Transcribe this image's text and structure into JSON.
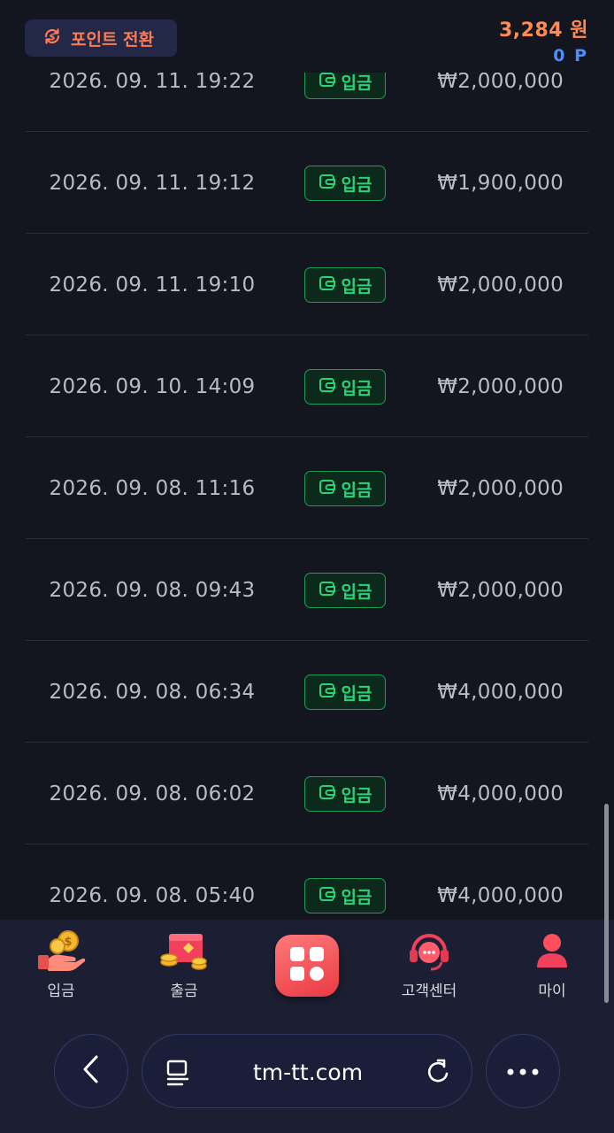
{
  "header": {
    "convert_button_label": "포인트 전환",
    "balance_won": "3,284 원",
    "balance_points": "0 P"
  },
  "transactions": [
    {
      "datetime": "2026. 09. 11. 19:22",
      "type": "입금",
      "amount": "₩2,000,000"
    },
    {
      "datetime": "2026. 09. 11. 19:12",
      "type": "입금",
      "amount": "₩1,900,000"
    },
    {
      "datetime": "2026. 09. 11. 19:10",
      "type": "입금",
      "amount": "₩2,000,000"
    },
    {
      "datetime": "2026. 09. 10. 14:09",
      "type": "입금",
      "amount": "₩2,000,000"
    },
    {
      "datetime": "2026. 09. 08. 11:16",
      "type": "입금",
      "amount": "₩2,000,000"
    },
    {
      "datetime": "2026. 09. 08. 09:43",
      "type": "입금",
      "amount": "₩2,000,000"
    },
    {
      "datetime": "2026. 09. 08. 06:34",
      "type": "입금",
      "amount": "₩4,000,000"
    },
    {
      "datetime": "2026. 09. 08. 06:02",
      "type": "입금",
      "amount": "₩4,000,000"
    },
    {
      "datetime": "2026. 09. 08. 05:40",
      "type": "입금",
      "amount": "₩4,000,000"
    }
  ],
  "bottom_nav": {
    "deposit_label": "입금",
    "withdraw_label": "출금",
    "support_label": "고객센터",
    "my_label": "마이"
  },
  "browser": {
    "url": "tm-tt.com"
  },
  "icons": {
    "convert": "currency-exchange-icon",
    "badge": "wallet-icon",
    "deposit": "coin-hand-icon",
    "withdraw": "gift-coins-icon",
    "center": "grid-menu-icon",
    "support": "headset-chat-icon",
    "my": "user-icon",
    "back": "chevron-left-icon",
    "tabs": "tabs-icon",
    "reload": "reload-icon",
    "more": "more-dots-icon"
  },
  "colors": {
    "background": "#13151f",
    "accent_orange": "#ff7a4f",
    "points_blue": "#4d8dff",
    "badge_green": "#27d477",
    "center_button_red": "#e93a43"
  }
}
